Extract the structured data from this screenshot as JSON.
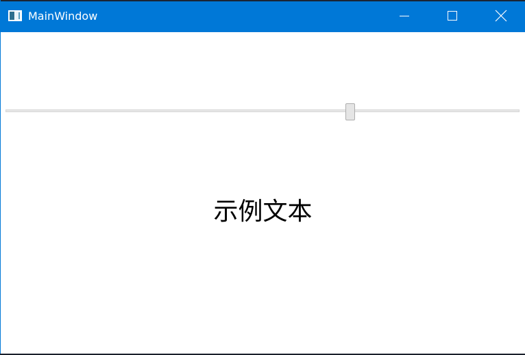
{
  "window": {
    "title": "MainWindow",
    "icon": "app-window-icon",
    "title_bar_color": "#0078d7",
    "title_text_color": "#ffffff",
    "background_color": "#ffffff"
  },
  "caption_buttons": {
    "minimize": "minimize-icon",
    "maximize": "maximize-icon",
    "close": "close-icon"
  },
  "slider": {
    "value_fraction": 0.673
  },
  "content": {
    "sample_text": "示例文本"
  }
}
